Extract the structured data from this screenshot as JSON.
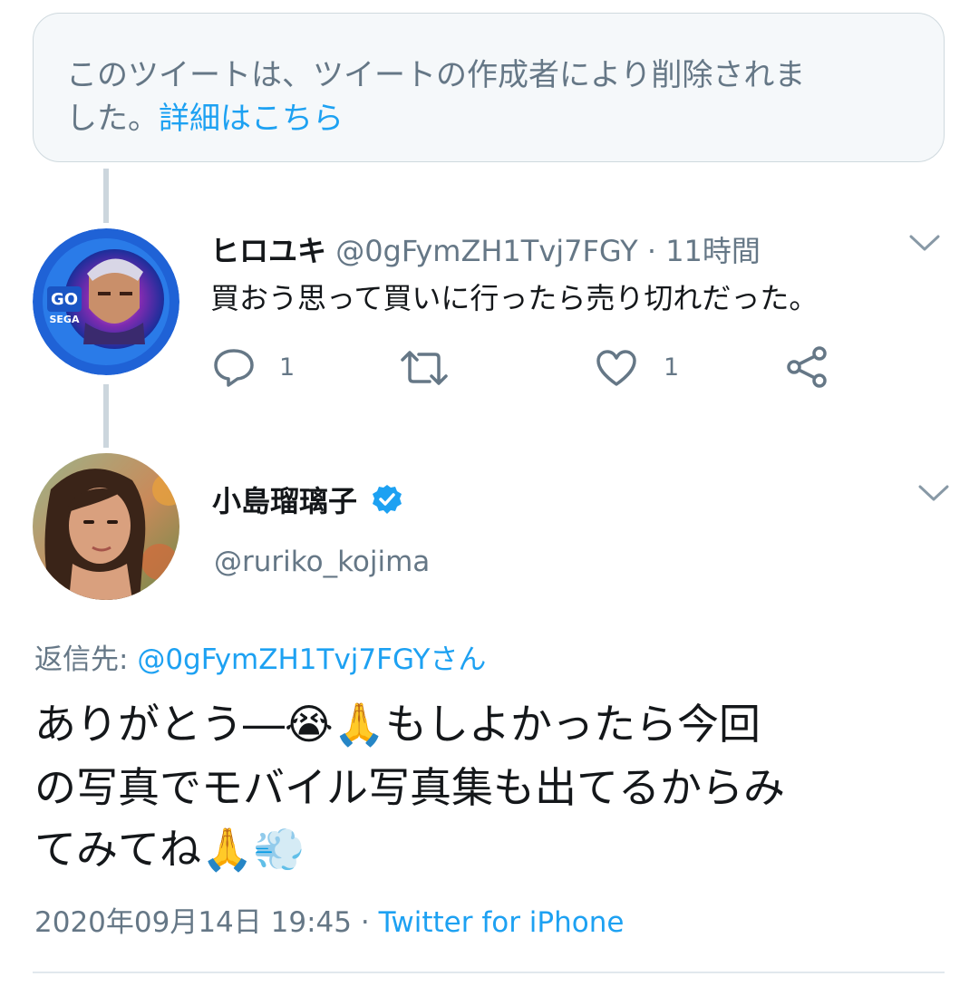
{
  "deleted_notice": {
    "line1": "このツイートは、ツイートの作成者により削除されま",
    "line2": "した。",
    "link": "詳細はこちら"
  },
  "reply_tweet": {
    "name": "ヒロユキ",
    "handle": "@0gFymZH1Tvj7FGY",
    "separator": "·",
    "time": "11時間",
    "text": "買おう思って買いに行ったら売り切れだった。",
    "avatar_badge": "GO SEGA",
    "actions": {
      "reply_count": "1",
      "retweet_count": "",
      "like_count": "1"
    }
  },
  "main_tweet": {
    "name": "小島瑠璃子",
    "handle": "@ruriko_kojima",
    "verified": true,
    "replying_to_label": "返信先:",
    "replying_to_handle": "@0gFymZH1Tvj7FGYさん",
    "text_line1": "ありがとう―😭🙏もしよかったら今回",
    "text_line2": "の写真でモバイル写真集も出てるからみ",
    "text_line3": "てみてね🙏💨",
    "timestamp": "2020年09月14日 19:45",
    "separator": "·",
    "source": "Twitter for iPhone"
  },
  "colors": {
    "accent": "#1da1f2",
    "muted_text": "#657786",
    "border": "#cfd9de",
    "thread_line": "#ccd6dd"
  },
  "icons": [
    "chevron-down-icon",
    "reply-icon",
    "retweet-icon",
    "like-icon",
    "share-icon",
    "verified-badge-icon"
  ]
}
